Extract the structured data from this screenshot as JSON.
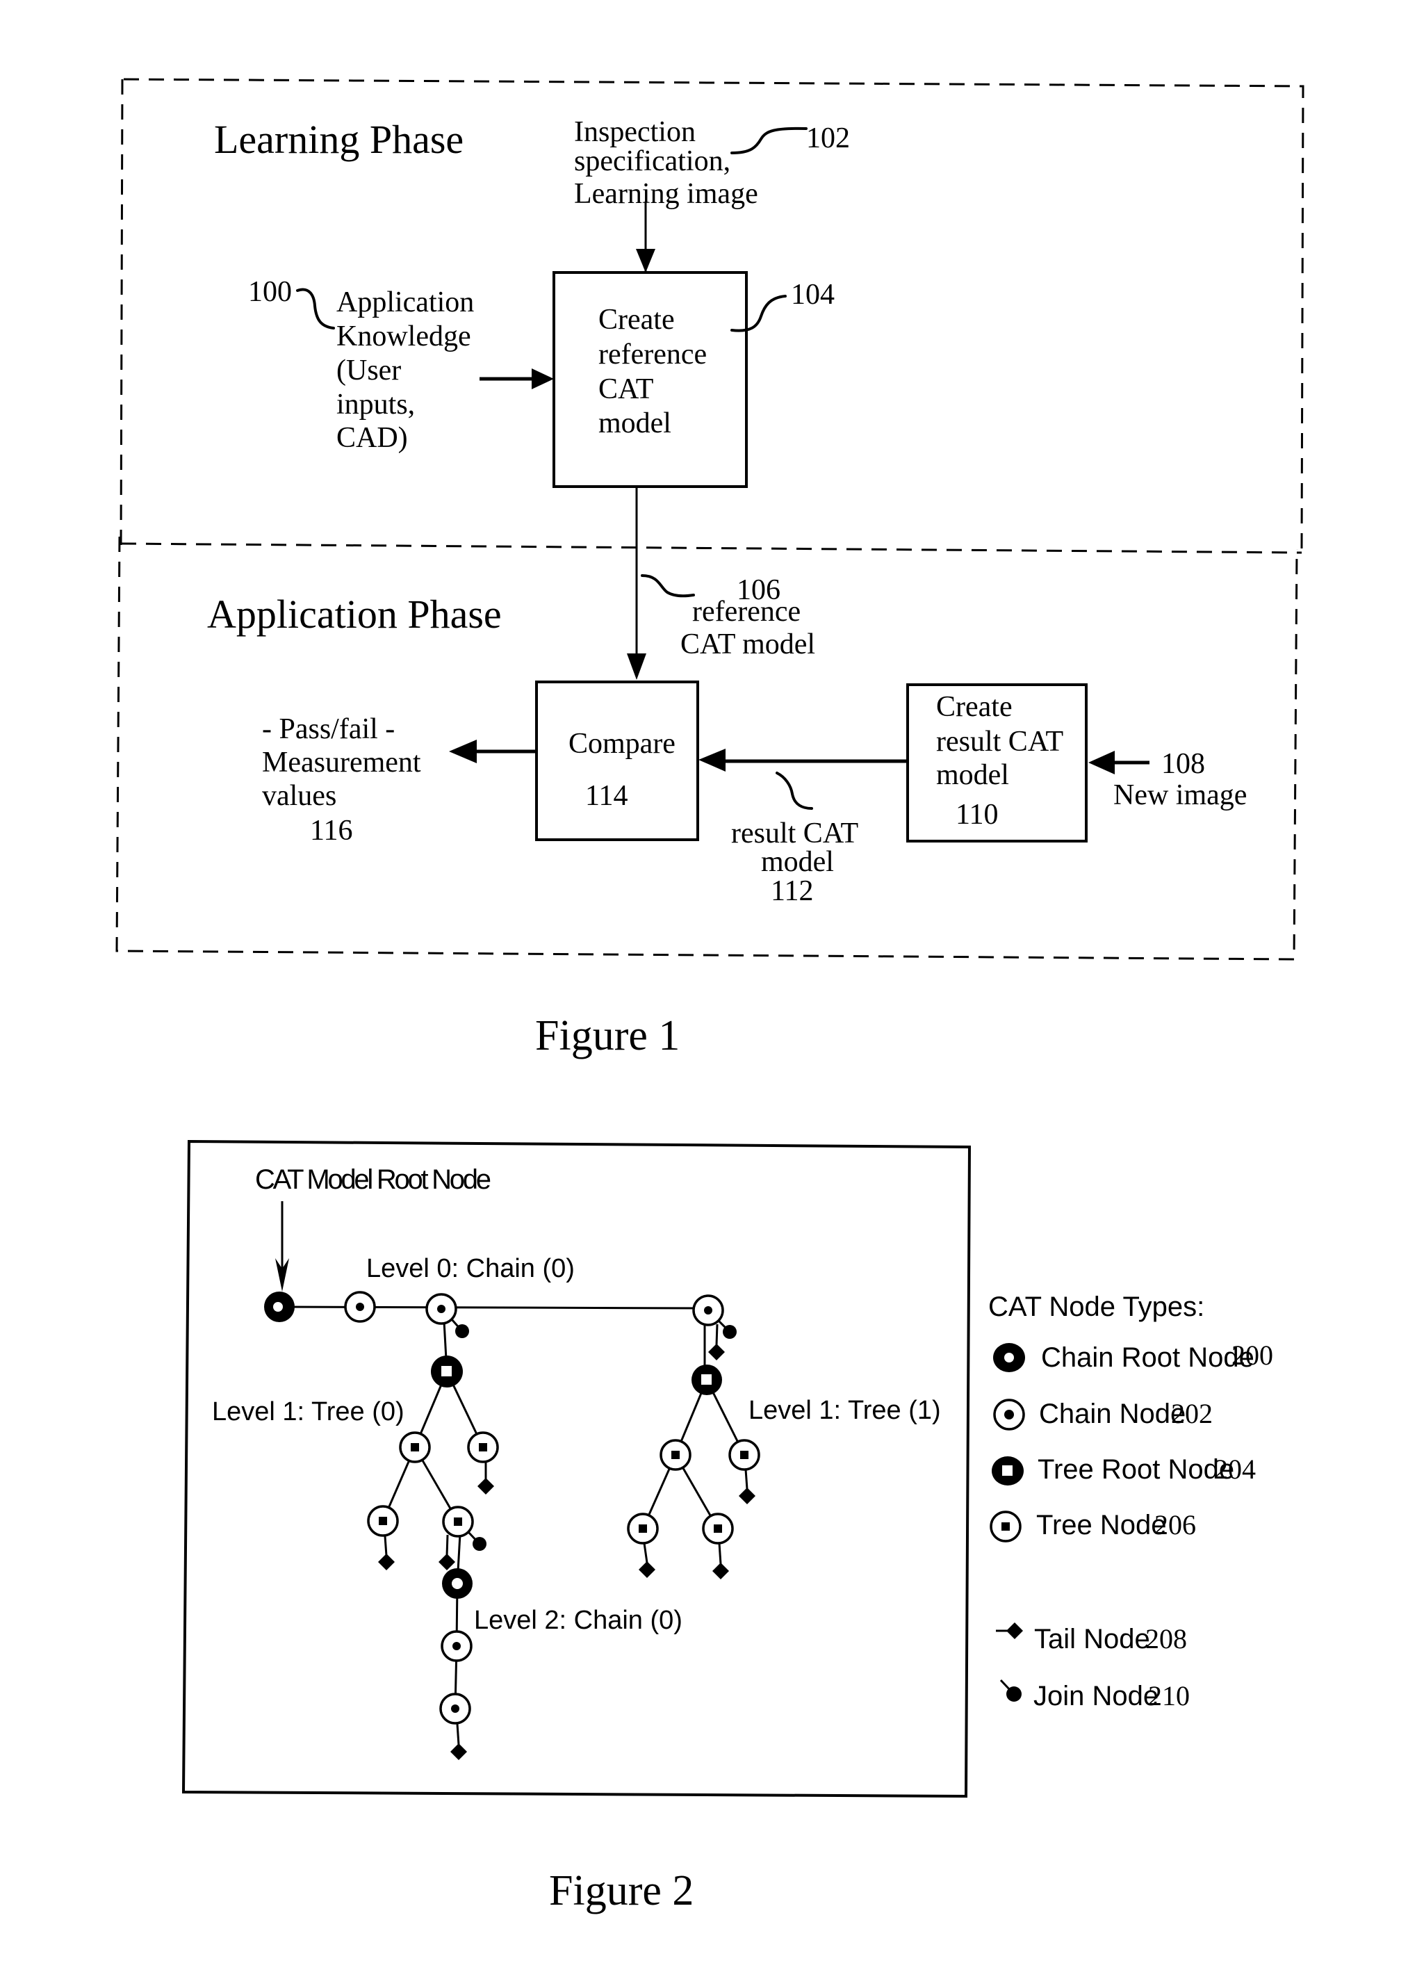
{
  "figure1": {
    "caption": "Figure 1",
    "learning_phase": {
      "title": "Learning Phase",
      "input_spec": {
        "lines": [
          "Inspection",
          "specification,",
          "Learning image"
        ],
        "ref": "102"
      },
      "app_knowledge": {
        "lines": [
          "Application",
          "Knowledge",
          "(User",
          "inputs,",
          "CAD)"
        ],
        "ref": "100"
      },
      "create_reference_box": {
        "lines": [
          "Create",
          "reference",
          "CAT",
          "model"
        ],
        "ref": "104"
      }
    },
    "application_phase": {
      "title": "Application Phase",
      "reference_model": {
        "ref": "106",
        "lines": [
          "reference",
          "CAT model"
        ]
      },
      "compare_box": {
        "label": "Compare",
        "ref": "114"
      },
      "output": {
        "lines": [
          "- Pass/fail -",
          "Measurement",
          "values"
        ],
        "ref": "116"
      },
      "result_model": {
        "lines": [
          "result CAT",
          "model"
        ],
        "ref": "112"
      },
      "create_result_box": {
        "lines": [
          "Create",
          "result CAT",
          "model"
        ],
        "ref": "110"
      },
      "new_image": {
        "ref": "108",
        "label": "New image"
      }
    }
  },
  "figure2": {
    "caption": "Figure 2",
    "root_label": "CAT Model Root Node",
    "level_labels": {
      "level0_chain0": "Level 0: Chain (0)",
      "level1_tree0": "Level 1: Tree (0)",
      "level1_tree1": "Level 1: Tree (1)",
      "level2_chain0": "Level 2: Chain (0)"
    },
    "legend": {
      "title": "CAT Node Types:",
      "items": [
        {
          "icon": "chain-root-node-icon",
          "label": "Chain Root Node",
          "ref": "200"
        },
        {
          "icon": "chain-node-icon",
          "label": "Chain Node",
          "ref": "202"
        },
        {
          "icon": "tree-root-node-icon",
          "label": "Tree Root Node",
          "ref": "204"
        },
        {
          "icon": "tree-node-icon",
          "label": "Tree Node",
          "ref": "206"
        },
        {
          "icon": "tail-node-icon",
          "label": "Tail Node",
          "ref": "208"
        },
        {
          "icon": "join-node-icon",
          "label": "Join Node",
          "ref": "210"
        }
      ]
    }
  }
}
